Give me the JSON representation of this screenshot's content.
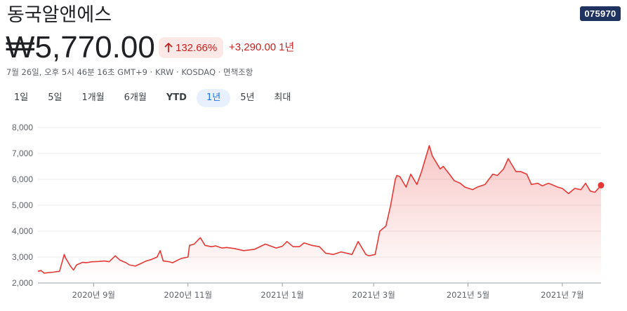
{
  "header": {
    "company_name": "동국알앤에스",
    "ticker": "075970",
    "price": "₩5,770.00",
    "change_percent": "132.66%",
    "change_amount": "+3,290.00",
    "period": "1년",
    "meta": "7월 26일, 오후 5시 46분 16초 GMT+9 · KRW · KOSDAQ · 면책조항"
  },
  "tabs": [
    {
      "label": "1일",
      "active": false
    },
    {
      "label": "5일",
      "active": false
    },
    {
      "label": "1개월",
      "active": false
    },
    {
      "label": "6개월",
      "active": false
    },
    {
      "label": "YTD",
      "active": false
    },
    {
      "label": "1년",
      "active": true
    },
    {
      "label": "5년",
      "active": false
    },
    {
      "label": "최대",
      "active": false
    }
  ],
  "colors": {
    "line": "#e53935",
    "positive": "#c5221f",
    "pill_bg": "#fce8e6",
    "active_tab_bg": "#e8f0fe",
    "active_tab_text": "#1a73e8",
    "badge_bg": "#1f3260"
  },
  "chart_data": {
    "type": "area",
    "ylim": [
      2000,
      8000
    ],
    "y_ticks": [
      2000,
      3000,
      4000,
      5000,
      6000,
      7000,
      8000
    ],
    "y_tick_labels": [
      "2,000",
      "3,000",
      "4,000",
      "5,000",
      "6,000",
      "7,000",
      "8,000"
    ],
    "x_ticks": [
      {
        "date": "2020-09-01",
        "label": "2020년 9월"
      },
      {
        "date": "2020-11-01",
        "label": "2020년 11월"
      },
      {
        "date": "2021-01-01",
        "label": "2021년 1월"
      },
      {
        "date": "2021-03-01",
        "label": "2021년 3월"
      },
      {
        "date": "2021-05-01",
        "label": "2021년 5월"
      },
      {
        "date": "2021-07-01",
        "label": "2021년 7월"
      }
    ],
    "grid": true,
    "series": [
      {
        "x": [
          "2020-07-27",
          "2020-07-29",
          "2020-07-31",
          "2020-08-03",
          "2020-08-06",
          "2020-08-10",
          "2020-08-13",
          "2020-08-14",
          "2020-08-17",
          "2020-08-19",
          "2020-08-21",
          "2020-08-25",
          "2020-08-27",
          "2020-08-31",
          "2020-09-04",
          "2020-09-08",
          "2020-09-11",
          "2020-09-15",
          "2020-09-18",
          "2020-09-22",
          "2020-09-24",
          "2020-09-28",
          "2020-10-05",
          "2020-10-08",
          "2020-10-12",
          "2020-10-14",
          "2020-10-16",
          "2020-10-20",
          "2020-10-22",
          "2020-10-26",
          "2020-10-28",
          "2020-11-01",
          "2020-11-02",
          "2020-11-05",
          "2020-11-09",
          "2020-11-12",
          "2020-11-16",
          "2020-11-19",
          "2020-11-23",
          "2020-11-26",
          "2020-12-01",
          "2020-12-07",
          "2020-12-14",
          "2020-12-21",
          "2020-12-28",
          "2021-01-01",
          "2021-01-04",
          "2021-01-08",
          "2021-01-12",
          "2021-01-15",
          "2021-01-20",
          "2021-01-25",
          "2021-01-29",
          "2021-02-03",
          "2021-02-08",
          "2021-02-15",
          "2021-02-19",
          "2021-02-24",
          "2021-02-26",
          "2021-03-02",
          "2021-03-05",
          "2021-03-09",
          "2021-03-12",
          "2021-03-15",
          "2021-03-16",
          "2021-03-18",
          "2021-03-22",
          "2021-03-25",
          "2021-03-29",
          "2021-04-01",
          "2021-04-06",
          "2021-04-08",
          "2021-04-13",
          "2021-04-15",
          "2021-04-19",
          "2021-04-22",
          "2021-04-26",
          "2021-04-29",
          "2021-05-04",
          "2021-05-07",
          "2021-05-12",
          "2021-05-17",
          "2021-05-20",
          "2021-05-24",
          "2021-05-27",
          "2021-06-01",
          "2021-06-04",
          "2021-06-08",
          "2021-06-11",
          "2021-06-15",
          "2021-06-18",
          "2021-06-22",
          "2021-06-24",
          "2021-06-28",
          "2021-07-01",
          "2021-07-05",
          "2021-07-09",
          "2021-07-13",
          "2021-07-16",
          "2021-07-19",
          "2021-07-22",
          "2021-07-26"
        ],
        "values": [
          2450,
          2480,
          2380,
          2400,
          2420,
          2450,
          3100,
          2950,
          2650,
          2500,
          2700,
          2800,
          2780,
          2820,
          2830,
          2850,
          2820,
          3050,
          2880,
          2780,
          2700,
          2650,
          2850,
          2900,
          3000,
          3250,
          2850,
          2820,
          2780,
          2900,
          2950,
          3000,
          3450,
          3500,
          3750,
          3450,
          3400,
          3430,
          3350,
          3370,
          3330,
          3250,
          3300,
          3500,
          3350,
          3420,
          3600,
          3400,
          3400,
          3550,
          3450,
          3400,
          3150,
          3100,
          3200,
          3100,
          3600,
          3100,
          3050,
          3100,
          4000,
          4200,
          5000,
          6000,
          6150,
          6100,
          5700,
          6200,
          5800,
          6300,
          7300,
          6900,
          6400,
          6500,
          6200,
          5950,
          5850,
          5700,
          5600,
          5700,
          5800,
          6200,
          6150,
          6400,
          6800,
          6300,
          6300,
          6200,
          5800,
          5850,
          5750,
          5850,
          5800,
          5700,
          5650,
          5450,
          5650,
          5600,
          5850,
          5550,
          5500,
          5770
        ]
      }
    ]
  }
}
